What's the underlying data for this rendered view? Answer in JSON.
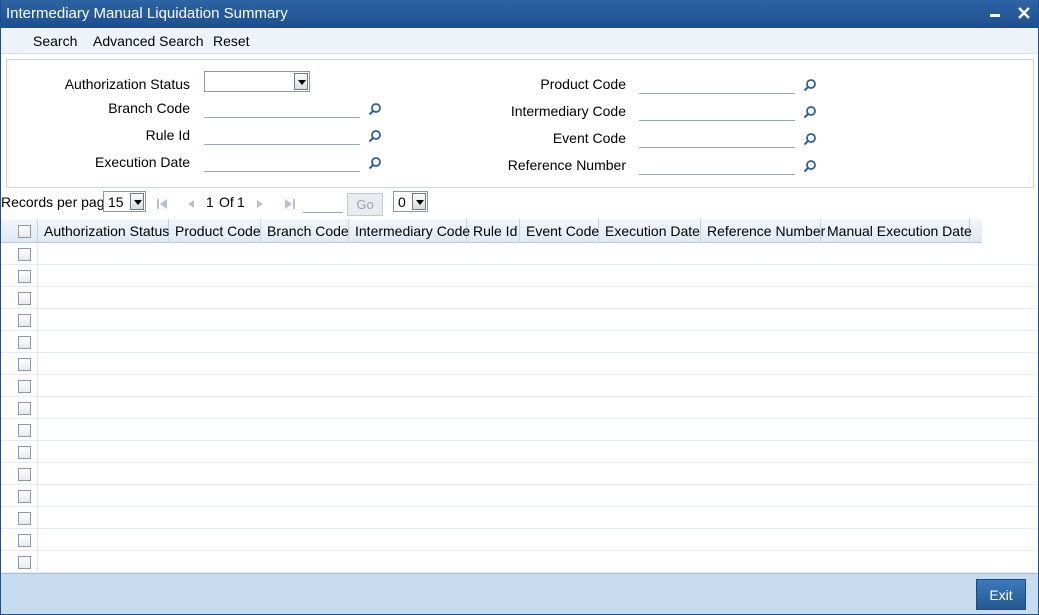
{
  "window": {
    "title": "Intermediary Manual Liquidation Summary",
    "minimize_icon": "minimize-icon",
    "close_icon": "close-icon"
  },
  "toolbar": {
    "search": "Search",
    "advanced_search": "Advanced Search",
    "reset": "Reset"
  },
  "criteria": {
    "authorization_status": {
      "label": "Authorization Status",
      "value": ""
    },
    "branch_code": {
      "label": "Branch Code",
      "value": ""
    },
    "rule_id": {
      "label": "Rule Id",
      "value": ""
    },
    "execution_date": {
      "label": "Execution Date",
      "value": ""
    },
    "product_code": {
      "label": "Product Code",
      "value": ""
    },
    "intermediary_code": {
      "label": "Intermediary Code",
      "value": ""
    },
    "event_code": {
      "label": "Event Code",
      "value": ""
    },
    "reference_number": {
      "label": "Reference Number",
      "value": ""
    }
  },
  "pager": {
    "records_per_page_label": "Records per page",
    "records_per_page_value": "15",
    "page_current": "1",
    "page_of": "Of",
    "page_total": "1",
    "go_label": "Go",
    "page_jump_value": "0"
  },
  "grid": {
    "columns": [
      "Authorization Status",
      "Product Code",
      "Branch Code",
      "Intermediary Code",
      "Rule Id",
      "Event Code",
      "Execution Date",
      "Reference Number",
      "Manual Execution Date"
    ],
    "row_count": 15
  },
  "footer": {
    "exit_label": "Exit"
  }
}
